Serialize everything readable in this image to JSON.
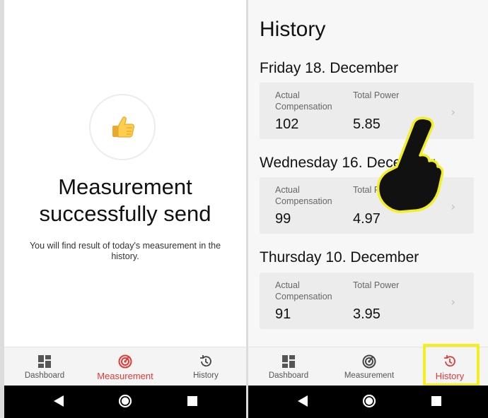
{
  "left_screen": {
    "success_title_line1": "Measurement",
    "success_title_line2": "successfully send",
    "success_message": "You will find result of today's measurement in the history.",
    "thumb_icon": "thumbs-up-icon",
    "nav": {
      "dashboard_label": "Dashboard",
      "measurement_label": "Measurement",
      "history_label": "History",
      "active": "Measurement"
    }
  },
  "right_screen": {
    "title": "History",
    "days": [
      {
        "heading": "Friday 18. December",
        "label_a": "Actual\nCompensation",
        "value_a": "102",
        "label_b": "Total Power",
        "value_b": "5.85"
      },
      {
        "heading": "Wednesday 16. December",
        "label_a": "Actual\nCompensation",
        "value_a": "99",
        "label_b": "Total Power",
        "value_b": "4.97"
      },
      {
        "heading": "Thursday 10. December",
        "label_a": "Actual\nCompensation",
        "value_a": "91",
        "label_b": "Total Power",
        "value_b": "3.95"
      }
    ],
    "nav": {
      "dashboard_label": "Dashboard",
      "measurement_label": "Measurement",
      "history_label": "History",
      "active": "History"
    }
  },
  "colors": {
    "accent_red": "#e53935",
    "highlight_yellow": "#f4ef1c",
    "card_bg": "#ececec"
  },
  "icons": [
    "dashboard-icon",
    "measurement-icon",
    "history-icon",
    "thumbs-up-icon",
    "pointing-hand-icon",
    "chevron-right-icon",
    "back-icon",
    "home-icon",
    "recents-icon"
  ]
}
